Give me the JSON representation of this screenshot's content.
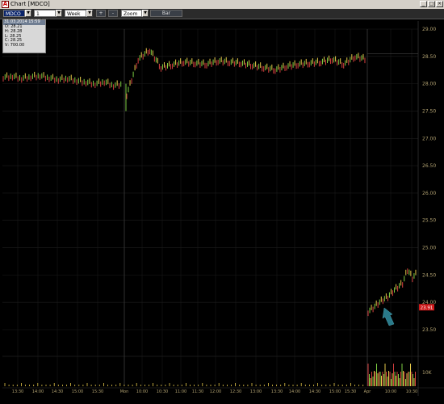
{
  "window": {
    "title": "Chart [MDCO]",
    "controls": [
      "_",
      "□",
      "×"
    ]
  },
  "toolbar": {
    "symbol": "MDCO",
    "interval": "1 minute",
    "period": "Week",
    "plus_label": "+",
    "minus_label": "-",
    "zoom": "Zoom",
    "style_button": "Bar"
  },
  "ohlc_box": {
    "header": "31.03.2014 15:59",
    "rows": [
      {
        "key": "O",
        "value": "28.21"
      },
      {
        "key": "H",
        "value": "28.28"
      },
      {
        "key": "L",
        "value": "28.25"
      },
      {
        "key": "C",
        "value": "28.25"
      },
      {
        "key": "V",
        "value": "700.00"
      }
    ]
  },
  "chart_data": {
    "type": "bar",
    "y_ticks": [
      "29.00",
      "28.50",
      "28.00",
      "27.50",
      "27.00",
      "26.50",
      "26.00",
      "25.50",
      "25.00",
      "24.50",
      "24.00",
      "23.50"
    ],
    "ylim": [
      23.5,
      29.0
    ],
    "x_ticks": [
      "13:30",
      "14:00",
      "14:30",
      "15:00",
      "15:30",
      "Mon",
      "10:00",
      "10:30",
      "11:00",
      "11:30",
      "12:00",
      "12:30",
      "13:00",
      "13:30",
      "14:00",
      "14:30",
      "15:00",
      "15:30",
      "Apr",
      "10:00",
      "10:30"
    ],
    "session_separators": [
      "Mon",
      "Apr"
    ],
    "last_price_label": "23.91",
    "volume_label": "10K",
    "series": [
      {
        "segment": "prior-session",
        "values": [
          28.12,
          28.14,
          28.1,
          28.13,
          28.15,
          28.11,
          28.08,
          28.1,
          28.06,
          28.03,
          28.0,
          28.04,
          27.97,
          28.0
        ]
      },
      {
        "segment": "Mon",
        "values": [
          27.8,
          28.45,
          28.62,
          28.3,
          28.35,
          28.4,
          28.38,
          28.36,
          28.42,
          28.4,
          28.38,
          28.34,
          28.3,
          28.26,
          28.32,
          28.36,
          28.38,
          28.4,
          28.45,
          28.36,
          28.5,
          28.45
        ]
      },
      {
        "segment": "Apr",
        "values": [
          23.83,
          23.9,
          23.98,
          24.05,
          24.1,
          24.2,
          24.28,
          24.35,
          24.6,
          24.45,
          24.55
        ]
      }
    ],
    "colors": {
      "up": "#7fd043",
      "down": "#d64040",
      "neutral": "#e6c84a",
      "grid": "#1c1c1c",
      "axis_text": "#b0a070"
    }
  }
}
